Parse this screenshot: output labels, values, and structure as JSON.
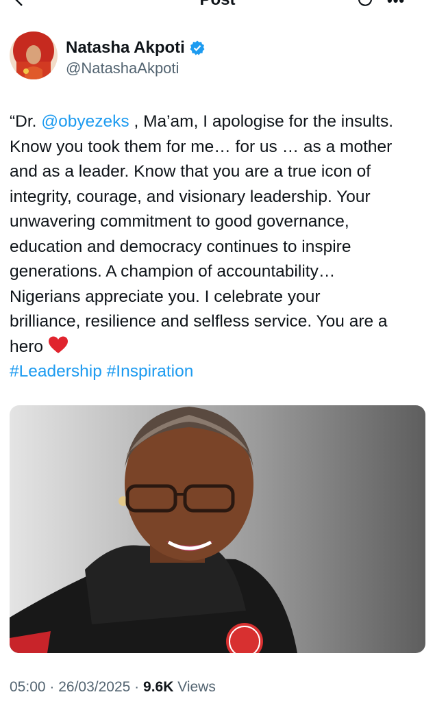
{
  "header": {
    "title": "Post"
  },
  "author": {
    "name": "Natasha Akpoti",
    "handle": "@NatashaAkpoti"
  },
  "tweet": {
    "line1_pre": "“Dr. ",
    "mention": "@obyezeks",
    "line1_post": " , Ma’am, I apologise for the insults.",
    "line2": "Know you took them for me… for us … as a mother",
    "line3": "and as a leader. Know that you are a true icon of",
    "line4": "integrity, courage, and visionary leadership. Your",
    "line5": "unwavering commitment to good governance,",
    "line6": "education and democracy continues to inspire",
    "line7": "generations. A champion of accountability…",
    "line8": "Nigerians appreciate you. I celebrate your",
    "line9": "brilliance, resilience and selfless service. You are a",
    "line10": "hero ",
    "hashtag1": "#Leadership",
    "hashtag2": "#Inspiration",
    "emoji": "red-heart"
  },
  "meta": {
    "time": "05:00",
    "separator": " · ",
    "date": "26/03/2025",
    "views_count": "9.6K",
    "views_label": " Views"
  },
  "icons": {
    "back": "back-arrow-icon",
    "refresh": "reply-refresh-icon",
    "more": "more-icon",
    "verified": "verified-badge-icon"
  },
  "colors": {
    "link": "#1d9bf0",
    "verified": "#1d9bf0",
    "secondary_text": "#536471",
    "text": "#0f1419"
  }
}
